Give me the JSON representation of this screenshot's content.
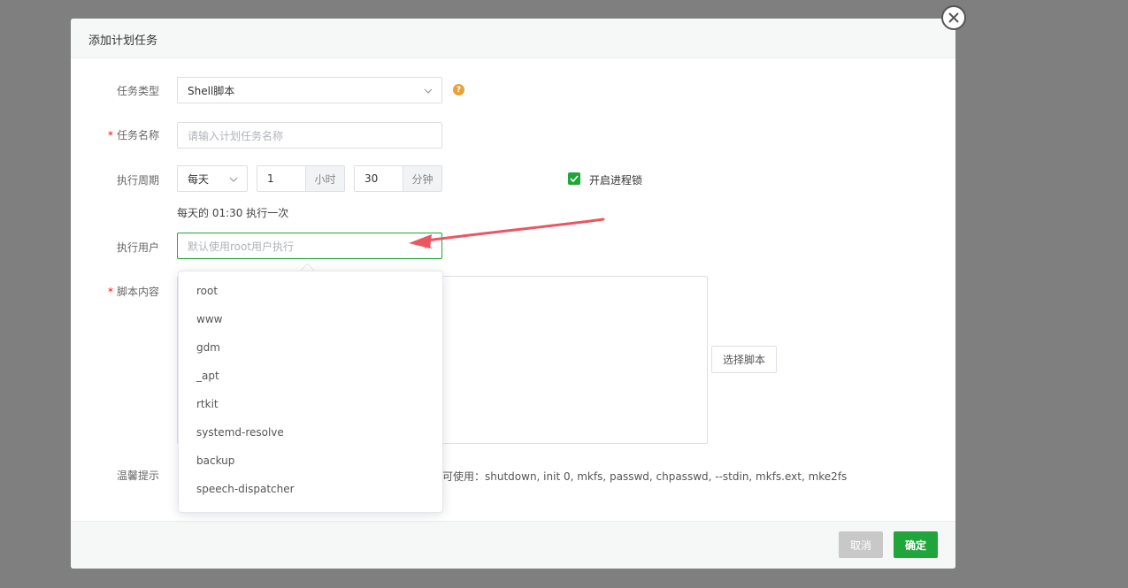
{
  "dialog": {
    "title": "添加计划任务"
  },
  "form": {
    "task_type": {
      "label": "任务类型",
      "value": "Shell脚本",
      "help": "?"
    },
    "task_name": {
      "label": "任务名称",
      "required": "*",
      "placeholder": "请输入计划任务名称"
    },
    "period": {
      "label": "执行周期",
      "frequency": "每天",
      "hour_value": "1",
      "hour_unit": "小时",
      "minute_value": "30",
      "minute_unit": "分钟",
      "summary": "每天的 01:30 执行一次"
    },
    "process_lock": {
      "label": "开启进程锁",
      "checked": true
    },
    "run_user": {
      "label": "执行用户",
      "placeholder": "默认使用root用户执行"
    },
    "script": {
      "label": "脚本内容",
      "required": "*",
      "select_button": "选择脚本"
    },
    "tips": {
      "label": "温馨提示",
      "text": "可使用：shutdown, init 0, mkfs, passwd, chpasswd, --stdin, mkfs.ext, mke2fs"
    }
  },
  "user_options": [
    "root",
    "www",
    "gdm",
    "_apt",
    "rtkit",
    "systemd-resolve",
    "backup",
    "speech-dispatcher"
  ],
  "footer": {
    "cancel": "取消",
    "confirm": "确定"
  },
  "colors": {
    "primary": "#20a53a",
    "warning": "#e6a23c",
    "annotation": "#ec5562",
    "overlay": "#7f7f7f"
  }
}
